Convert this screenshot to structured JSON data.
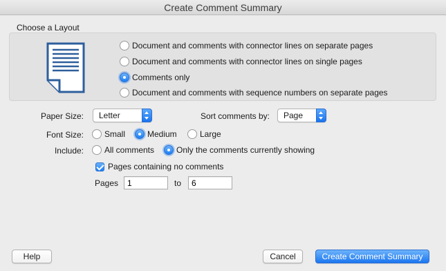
{
  "window": {
    "title": "Create Comment Summary"
  },
  "layout_group": {
    "label": "Choose a Layout",
    "options": [
      {
        "label": "Document and comments with connector lines on separate pages",
        "selected": false
      },
      {
        "label": "Document and comments with connector lines on single pages",
        "selected": false
      },
      {
        "label": "Comments only",
        "selected": true
      },
      {
        "label": "Document and comments with sequence numbers on separate pages",
        "selected": false
      }
    ]
  },
  "paper_size": {
    "label": "Paper Size:",
    "value": "Letter"
  },
  "sort": {
    "label": "Sort comments by:",
    "value": "Page"
  },
  "font_size": {
    "label": "Font Size:",
    "options": [
      {
        "label": "Small",
        "selected": false
      },
      {
        "label": "Medium",
        "selected": true
      },
      {
        "label": "Large",
        "selected": false
      }
    ]
  },
  "include": {
    "label": "Include:",
    "options": [
      {
        "label": "All comments",
        "selected": false
      },
      {
        "label": "Only the comments currently showing",
        "selected": true
      }
    ]
  },
  "no_comments_pages": {
    "label": "Pages containing no comments",
    "checked": true
  },
  "pages": {
    "label": "Pages",
    "from": "1",
    "to_label": "to",
    "to": "6"
  },
  "buttons": {
    "help": "Help",
    "cancel": "Cancel",
    "create": "Create Comment Summary"
  },
  "colors": {
    "accent": "#1d7ff5",
    "doc_icon": "#2e5f9c"
  }
}
